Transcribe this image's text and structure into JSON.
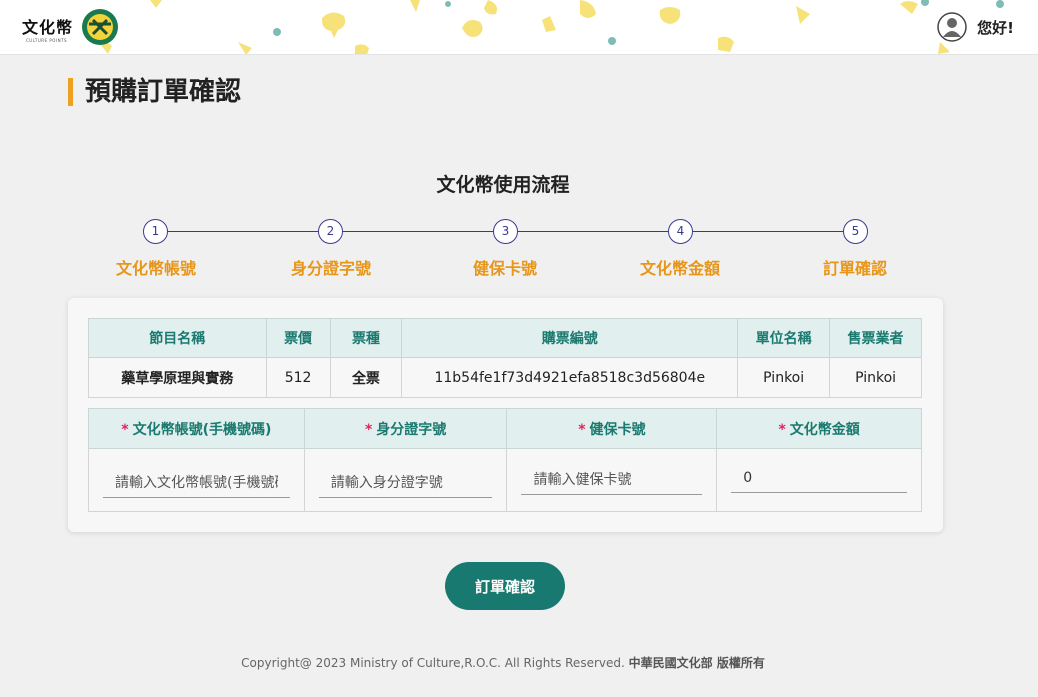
{
  "header": {
    "logo_text": "文化幣",
    "logo_sub": "CULTURE POINTS",
    "greeting": "您好!",
    "colors": {
      "yellow": "#f7e27a",
      "teal": "#7fbcb6"
    }
  },
  "page_title": "預購訂單確認",
  "flow": {
    "title": "文化幣使用流程",
    "steps": [
      {
        "num": "1",
        "label": "文化幣帳號"
      },
      {
        "num": "2",
        "label": "身分證字號"
      },
      {
        "num": "3",
        "label": "健保卡號"
      },
      {
        "num": "4",
        "label": "文化幣金額"
      },
      {
        "num": "5",
        "label": "訂單確認"
      }
    ]
  },
  "order_table": {
    "headers": [
      "節目名稱",
      "票價",
      "票種",
      "購票編號",
      "單位名稱",
      "售票業者"
    ],
    "row": [
      "藥草學原理與實務",
      "512",
      "全票",
      "11b54fe1f73d4921efa8518c3d56804e",
      "Pinkoi",
      "Pinkoi"
    ]
  },
  "form": {
    "required_mark": "*",
    "fields": [
      {
        "label": "文化幣帳號(手機號碼)",
        "placeholder": "請輸入文化幣帳號(手機號碼)",
        "value": ""
      },
      {
        "label": "身分證字號",
        "placeholder": "請輸入身分證字號",
        "value": ""
      },
      {
        "label": "健保卡號",
        "placeholder": "請輸入健保卡號",
        "value": ""
      },
      {
        "label": "文化幣金額",
        "placeholder": "",
        "value": "0"
      }
    ]
  },
  "confirm_button": "訂單確認",
  "footer": {
    "text": "Copyright@ 2023 Ministry of Culture,R.O.C. All Rights Reserved.",
    "bold": "中華民國文化部 版權所有"
  },
  "colors": {
    "accent": "#17796f",
    "step_label": "#e8961a",
    "required": "#e0245e",
    "title_bar": "#f0a020"
  }
}
